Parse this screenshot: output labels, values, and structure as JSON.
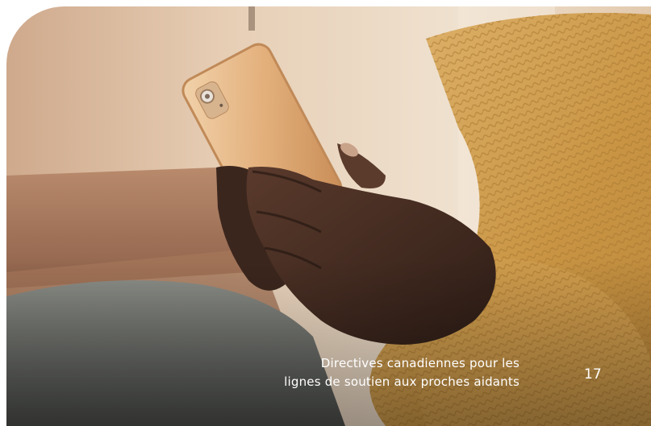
{
  "document": {
    "footer_line1": "Directives canadiennes pour les",
    "footer_line2": "lignes de soutien aux proches aidants",
    "page_number": "17"
  },
  "photo": {
    "subject": "person-holding-smartphone-photo"
  },
  "colors": {
    "footer_text": "#ffffff",
    "background": "#ffffff"
  }
}
